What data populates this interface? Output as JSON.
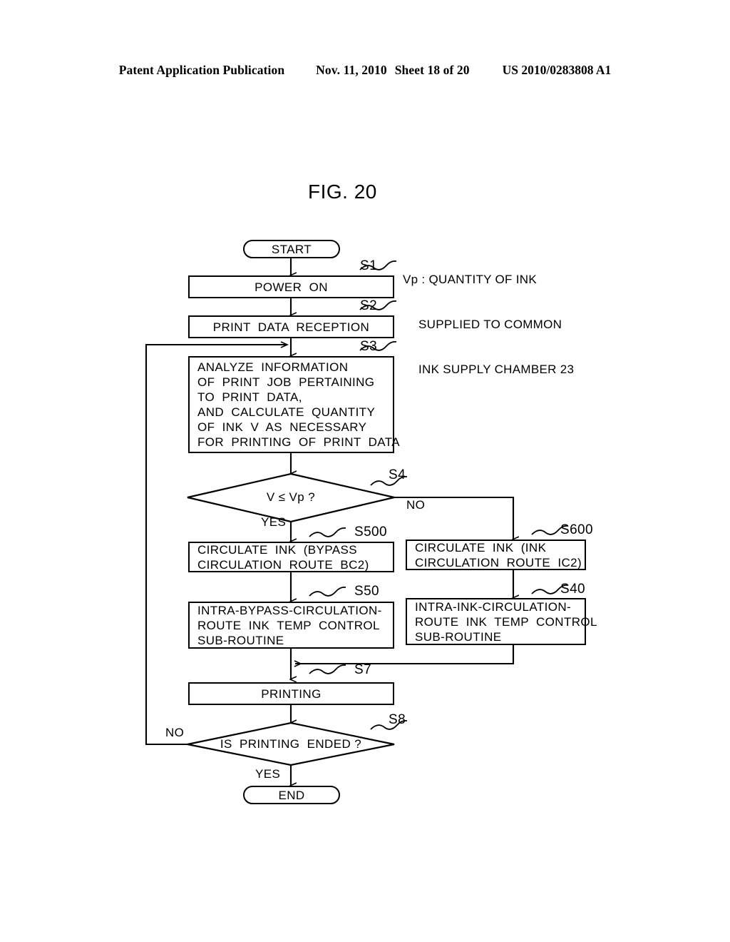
{
  "header": {
    "publication": "Patent Application Publication",
    "date": "Nov. 11, 2010",
    "sheet": "Sheet 18 of 20",
    "number": "US 2010/0283808 A1"
  },
  "figure": {
    "title": "FIG. 20"
  },
  "legend": {
    "line1": "Vp : QUANTITY OF INK",
    "line2": "SUPPLIED TO COMMON",
    "line3": "INK SUPPLY CHAMBER 23"
  },
  "flowchart": {
    "start": {
      "label": "START"
    },
    "end": {
      "label": "END"
    },
    "steps": [
      {
        "id": "S1",
        "ref": "S1",
        "text": "POWER  ON"
      },
      {
        "id": "S2",
        "ref": "S2",
        "text": "PRINT  DATA  RECEPTION"
      },
      {
        "id": "S3",
        "ref": "S3",
        "text": "ANALYZE  INFORMATION\nOF  PRINT  JOB  PERTAINING\nTO  PRINT  DATA,\nAND  CALCULATE  QUANTITY\nOF  INK  V  AS  NECESSARY\nFOR  PRINTING  OF  PRINT  DATA"
      },
      {
        "id": "S500",
        "ref": "S500",
        "text": "CIRCULATE  INK  (BYPASS\nCIRCULATION  ROUTE  BC2)"
      },
      {
        "id": "S600",
        "ref": "S600",
        "text": "CIRCULATE  INK  (INK\nCIRCULATION  ROUTE  IC2)"
      },
      {
        "id": "S50",
        "ref": "S50",
        "text": "INTRA-BYPASS-CIRCULATION-\nROUTE  INK  TEMP  CONTROL\nSUB-ROUTINE"
      },
      {
        "id": "S40",
        "ref": "S40",
        "text": "INTRA-INK-CIRCULATION-\nROUTE  INK  TEMP  CONTROL\nSUB-ROUTINE"
      },
      {
        "id": "S7",
        "ref": "S7",
        "text": "PRINTING"
      }
    ],
    "decisions": [
      {
        "id": "S4",
        "ref": "S4",
        "text": "V ≤ Vp ?",
        "yes": "YES",
        "no": "NO"
      },
      {
        "id": "S8",
        "ref": "S8",
        "text": "IS  PRINTING  ENDED ?",
        "yes": "YES",
        "no": "NO"
      }
    ]
  },
  "colors": {
    "ink": "#000000",
    "paper": "#ffffff"
  }
}
